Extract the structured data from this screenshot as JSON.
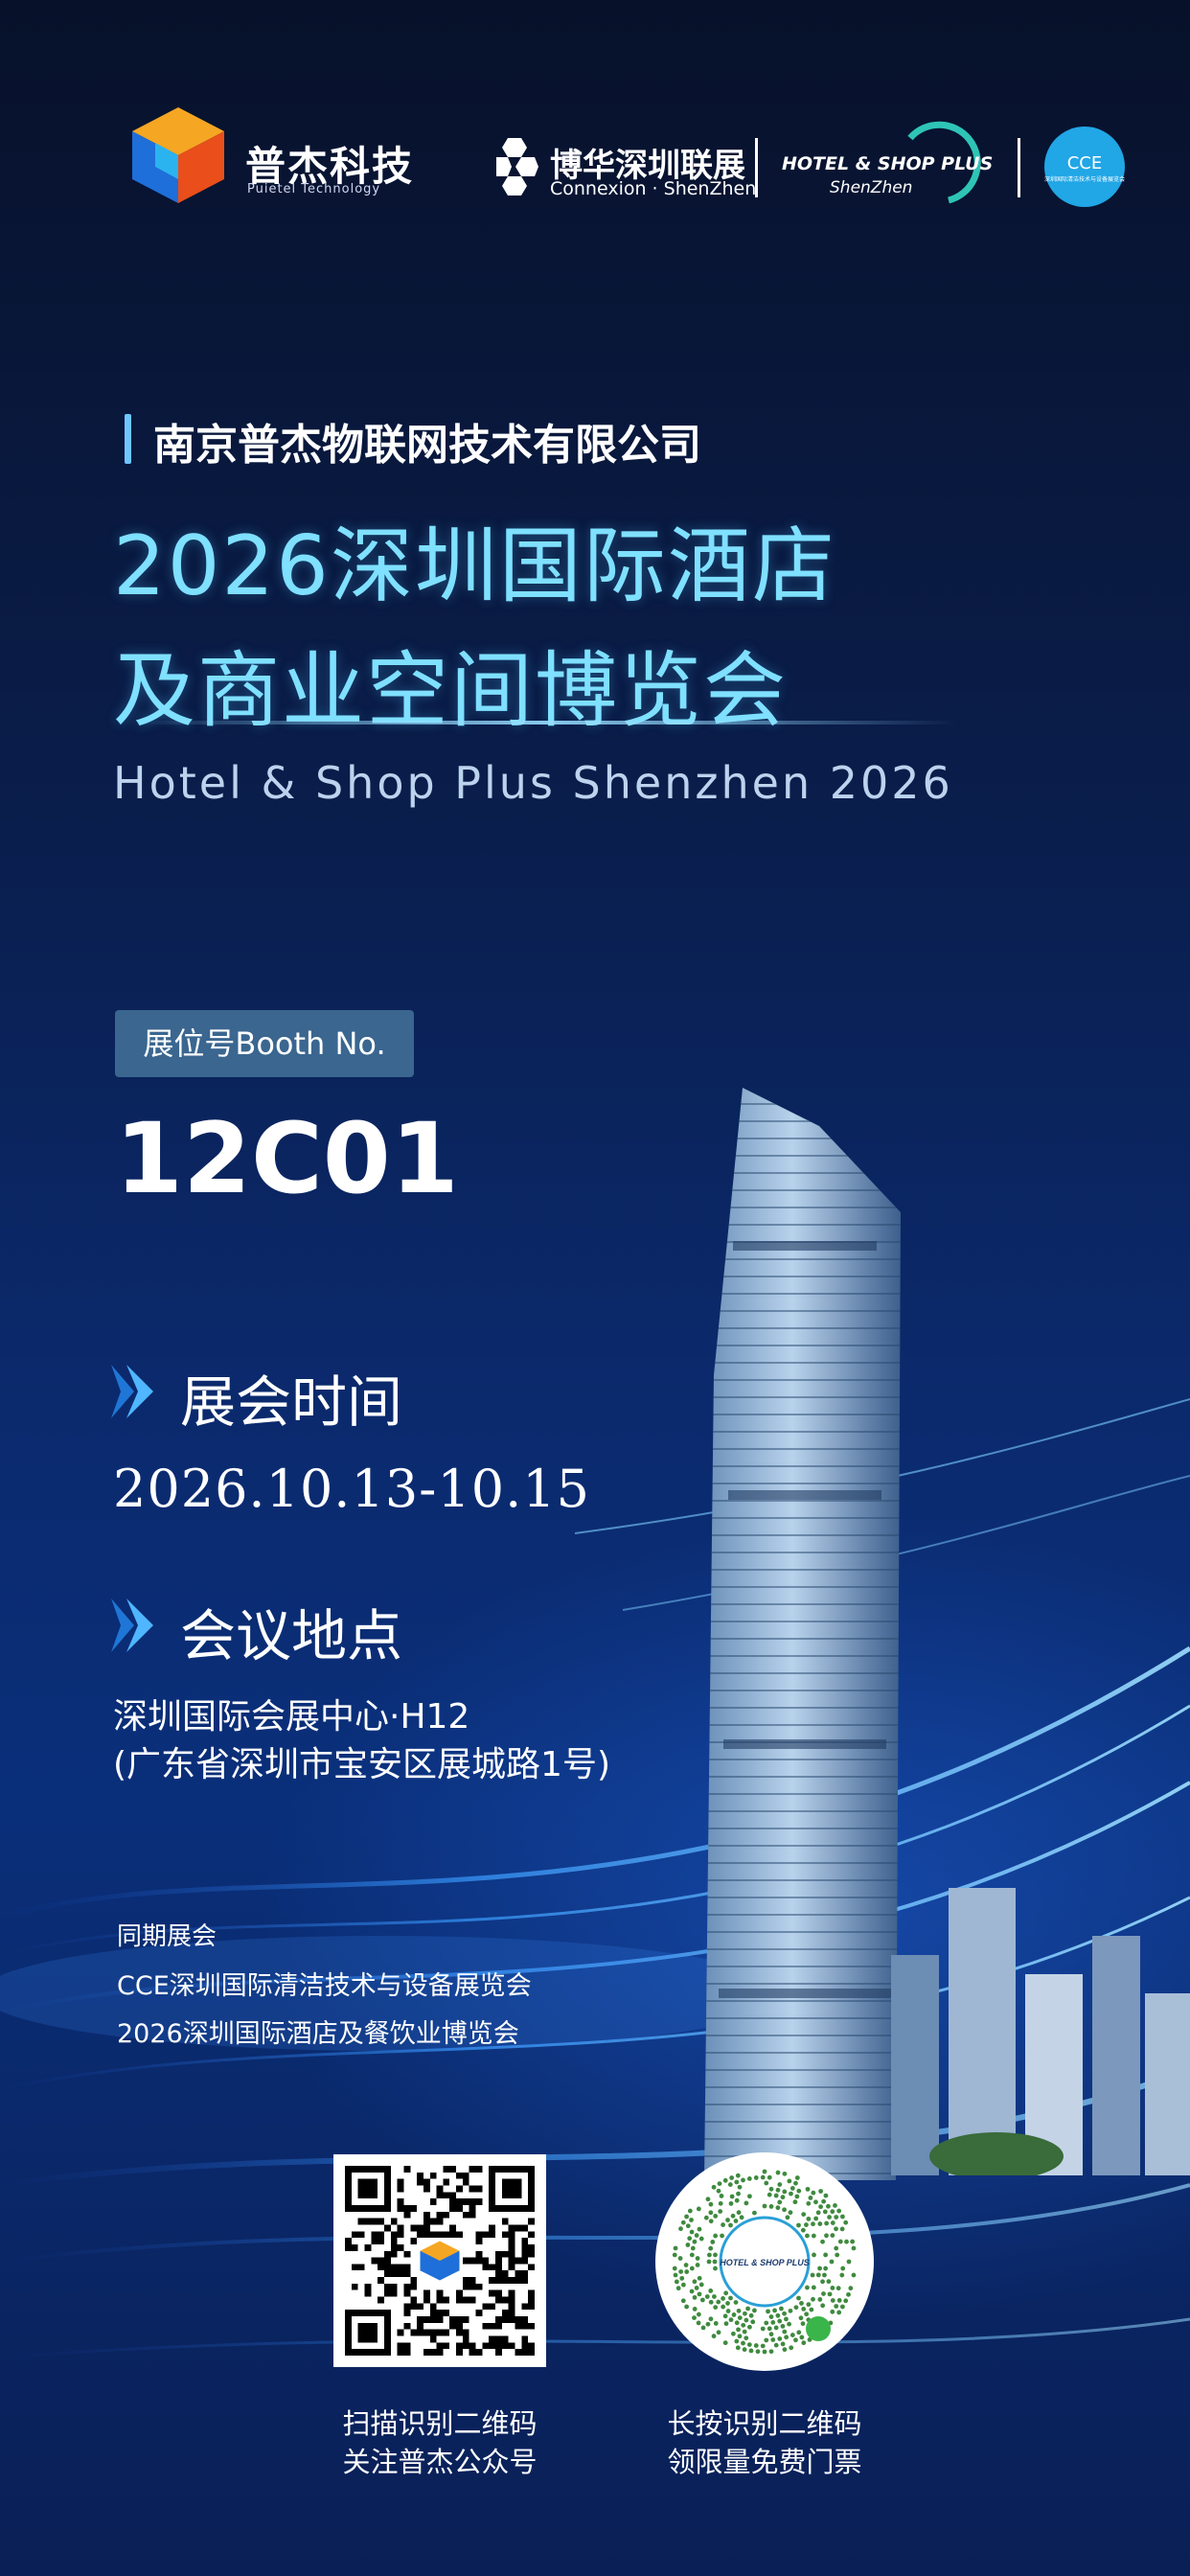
{
  "header": {
    "puiete_logo_name": "普杰科技",
    "puiete_logo_sub": "Puietel  Technology",
    "connexion_cn": "博华深圳联展",
    "connexion_en": "Connexion · ShenZhen",
    "hotel_logo_text": "HOTEL & SHOP PLUS",
    "hotel_logo_city": "ShenZhen",
    "cce_logo_text": "CCE",
    "cce_logo_sub": "深圳国际清洁技术与设备展览会"
  },
  "company": "南京普杰物联网技术有限公司",
  "title": {
    "line1": "2026深圳国际酒店",
    "line2": "及商业空间博览会",
    "english": "Hotel & Shop Plus Shenzhen 2026"
  },
  "booth": {
    "label": "展位号Booth No.",
    "number": "12C01"
  },
  "schedule": {
    "heading": "展会时间",
    "dates": "2026.10.13-10.15"
  },
  "venue": {
    "heading": "会议地点",
    "name": "深圳国际会展中心·H12",
    "address": "(广东省深圳市宝安区展城路1号)"
  },
  "concurrent": {
    "title": "同期展会",
    "items": [
      "CCE深圳国际清洁技术与设备展览会",
      "2026深圳国际酒店及餐饮业博览会"
    ]
  },
  "qr": {
    "wechat_caption_1": "扫描识别二维码",
    "wechat_caption_2": "关注普杰公众号",
    "mini_caption_1": "长按识别二维码",
    "mini_caption_2": "领限量免费门票",
    "mini_center_text": "HOTEL & SHOP PLUS"
  },
  "colors": {
    "background": "#0a1d4a",
    "title_cyan": "#7fe0ff",
    "booth_label_bg": "#3a6690",
    "chevron": "#4fb6ff",
    "cce_blue": "#21a6e6"
  }
}
